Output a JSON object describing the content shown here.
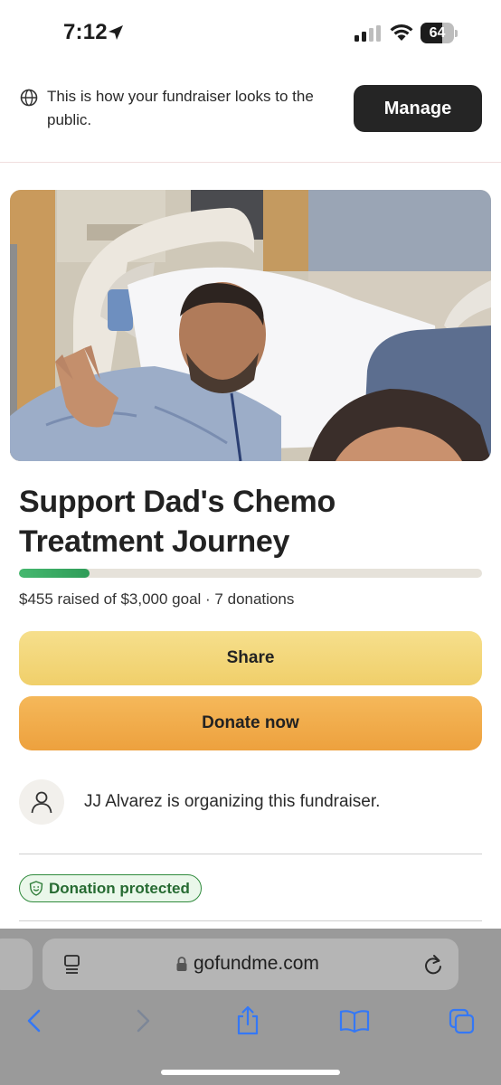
{
  "status_bar": {
    "time": "7:12",
    "battery": "64",
    "battery_level": 0.64
  },
  "banner": {
    "text": "This is how your fundraiser looks to the public.",
    "manage_label": "Manage"
  },
  "fundraiser": {
    "title": "Support Dad's Chemo Treatment Journey",
    "raised_text": "$455 raised of $3,000 goal · 7 donations",
    "progress_fraction": 0.152
  },
  "actions": {
    "share_label": "Share",
    "donate_label": "Donate now"
  },
  "organizer": {
    "text": "JJ Alvarez is organizing this fundraiser."
  },
  "badge": {
    "label": "Donation protected"
  },
  "browser": {
    "url": "gofundme.com"
  },
  "colors": {
    "progress_green": "#3fae66",
    "share_yellow": "#f2d576",
    "donate_orange": "#f0aa48",
    "manage_dark": "#252525",
    "toolbar_blue": "#3478f6"
  },
  "icons": [
    "location-arrow-icon",
    "signal-icon",
    "wifi-icon",
    "battery-icon",
    "globe-icon",
    "user-icon",
    "shield-smile-icon",
    "tabs-icon",
    "lock-icon",
    "reload-icon",
    "back-icon",
    "forward-icon",
    "share-icon",
    "bookmarks-icon",
    "tabs-overview-icon"
  ]
}
